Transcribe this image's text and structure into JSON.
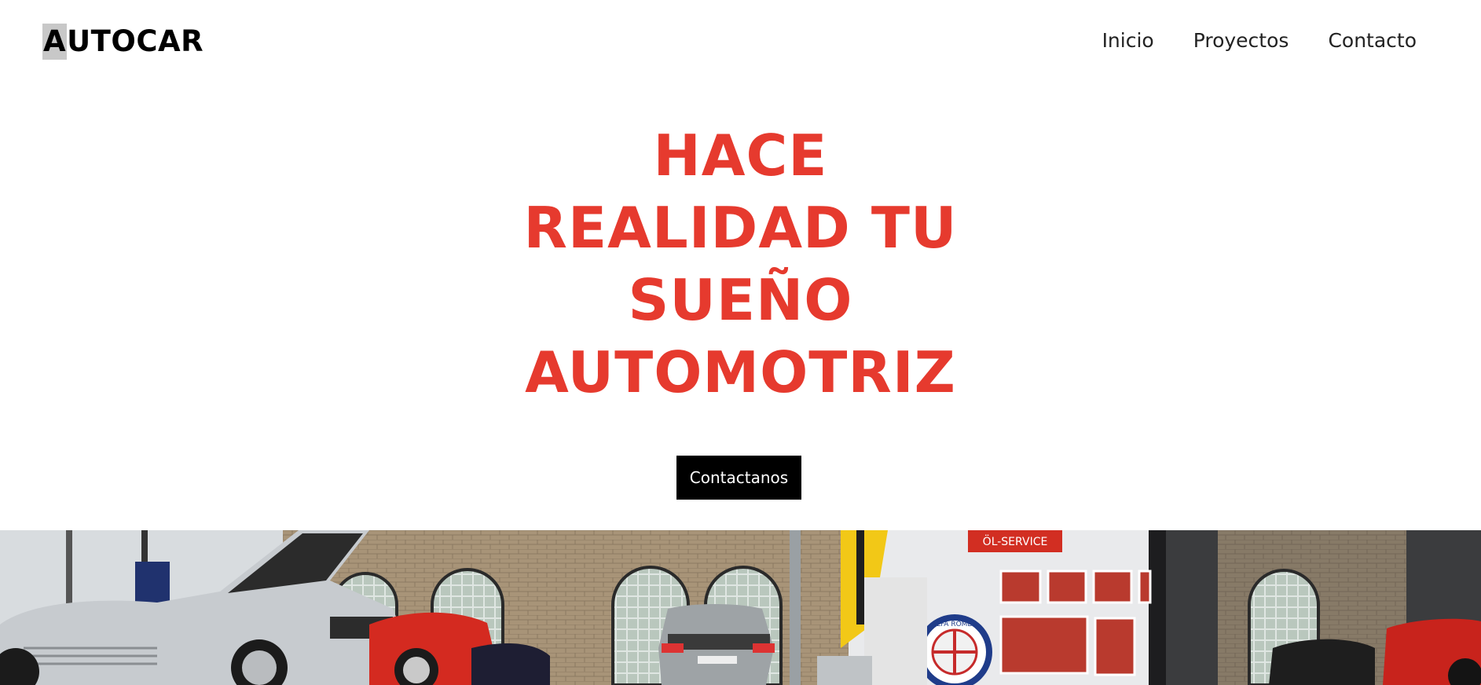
{
  "header": {
    "logo_first_letter": "A",
    "logo_rest": "UTOCAR",
    "nav": [
      {
        "label": "Inicio"
      },
      {
        "label": "Proyectos"
      },
      {
        "label": "Contacto"
      }
    ]
  },
  "hero": {
    "title_lines": [
      "HACE",
      "REALIDAD TU",
      "SUEÑO",
      "AUTOMOTRIZ"
    ],
    "cta_label": "Contactanos"
  },
  "garage_image": {
    "sign_text": "ÖL-SERVICE",
    "badge_text": "ALFA ROMEO"
  },
  "colors": {
    "accent": "#e63a2e",
    "text": "#222222",
    "button_bg": "#000000",
    "button_text": "#ffffff"
  }
}
